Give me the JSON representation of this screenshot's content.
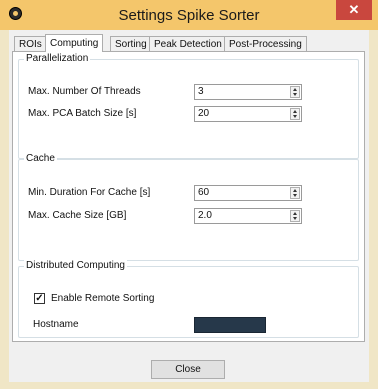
{
  "window": {
    "title": "Settings Spike Sorter",
    "close_glyph": "✕"
  },
  "tabs": [
    {
      "label": "ROIs"
    },
    {
      "label": "Computing"
    },
    {
      "label": "Sorting"
    },
    {
      "label": "Peak Detection"
    },
    {
      "label": "Post-Processing"
    }
  ],
  "active_tab": "Computing",
  "parallelization": {
    "title": "Parallelization",
    "threads_label": "Max. Number Of Threads",
    "threads_value": "3",
    "batch_label": "Max. PCA Batch Size [s]",
    "batch_value": "20"
  },
  "cache": {
    "title": "Cache",
    "min_duration_label": "Min. Duration For Cache [s]",
    "min_duration_value": "60",
    "max_size_label": "Max. Cache Size [GB]",
    "max_size_value": "2.0"
  },
  "distributed": {
    "title": "Distributed Computing",
    "remote_label": "Enable Remote Sorting",
    "remote_checked": true,
    "check_glyph": "✓",
    "hostname_label": "Hostname"
  },
  "footer": {
    "close_label": "Close"
  },
  "colors": {
    "title_bar": "#f4c66b",
    "close_button": "#c9473e",
    "hostname_field": "#26384a"
  },
  "icons": {
    "app": "app-icon",
    "close": "close-icon",
    "spin": "spin-arrows-icon",
    "check": "checkmark-icon"
  }
}
